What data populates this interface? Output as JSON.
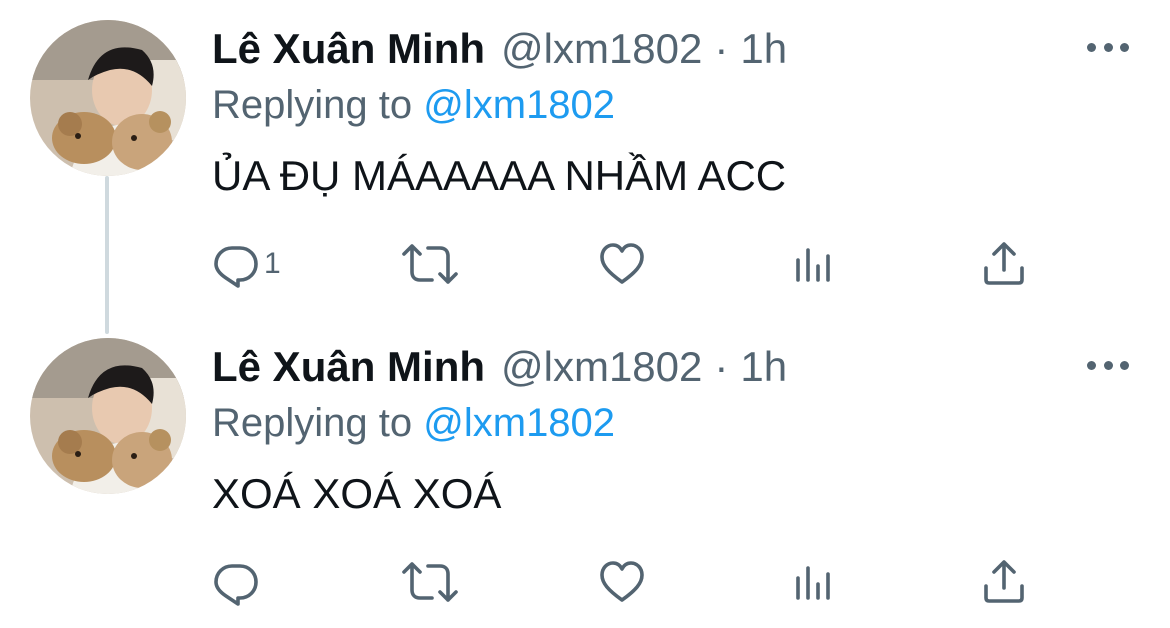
{
  "tweets": [
    {
      "author_name": "Lê Xuân Minh",
      "handle": "@lxm1802",
      "separator": "·",
      "time": "1h",
      "replying_prefix": "Replying to",
      "replying_to": "@lxm1802",
      "text": "ỦA ĐỤ MÁAAAAA NHẦM ACC",
      "reply_count": "1"
    },
    {
      "author_name": "Lê Xuân Minh",
      "handle": "@lxm1802",
      "separator": "·",
      "time": "1h",
      "replying_prefix": "Replying to",
      "replying_to": "@lxm1802",
      "text": "XOÁ XOÁ XOÁ",
      "reply_count": ""
    }
  ],
  "colors": {
    "text": "#0f1419",
    "secondary": "#536471",
    "mention": "#1d9bf0",
    "thread_line": "#cfd9de"
  },
  "icons": [
    "reply-icon",
    "retweet-icon",
    "like-icon",
    "analytics-icon",
    "share-icon",
    "more-icon"
  ]
}
